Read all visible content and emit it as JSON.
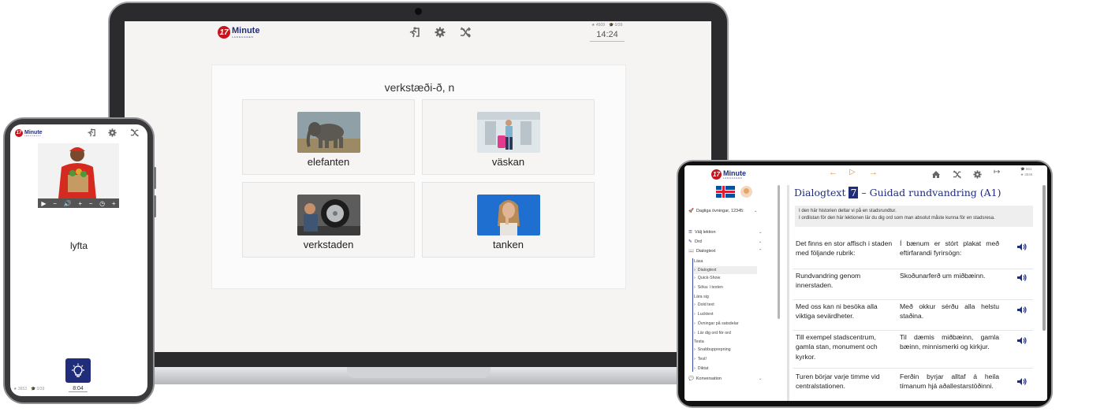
{
  "brand": {
    "logo_number": "17",
    "logo_name": "Minute",
    "logo_sub": "LANGUAGES",
    "accent": "#c8141c",
    "navy": "#1f2d7a"
  },
  "laptop": {
    "stats": {
      "stars": "4509",
      "hats": "0/39"
    },
    "timer": "14:24",
    "word": "verkstæði-ð, n",
    "choices": [
      {
        "label": "elefanten",
        "image": "elephant"
      },
      {
        "label": "väskan",
        "image": "suitcase-traveler"
      },
      {
        "label": "verkstaden",
        "image": "mechanic-tire"
      },
      {
        "label": "tanken",
        "image": "thinking-woman"
      }
    ],
    "toolbar": {
      "exit_icon": "exit-icon",
      "settings_icon": "gear-icon",
      "shuffle_icon": "shuffle-off-icon"
    }
  },
  "phone": {
    "word": "lyfta",
    "stats": {
      "stars": "3653",
      "hats": "0/39"
    },
    "timer": "8:04",
    "video_controls": [
      "play-icon",
      "minus-icon",
      "volume-icon",
      "plus-icon",
      "minus-icon",
      "speed-icon",
      "plus-icon"
    ],
    "hint_icon": "lightbulb-icon"
  },
  "tablet": {
    "stats": {
      "hats": "561",
      "stars": "3545"
    },
    "nav": {
      "prev_icon": "arrow-left-icon",
      "play_icon": "play-icon",
      "next_icon": "arrow-right-icon"
    },
    "sidebar": {
      "daily": "Dagliga övningar, 12345:",
      "choose_lesson": "Välj lektion",
      "words": "Ord",
      "dialog": "Dialogtext",
      "groups": [
        {
          "title": "Läsa",
          "items": [
            "Dialogtext",
            "Quick-Show",
            "Söka: i texten"
          ]
        },
        {
          "title": "Lära sig",
          "items": [
            "Dold text",
            "Lucktext",
            "Övningar på satsdelar",
            "Lär dig ord för ord"
          ]
        },
        {
          "title": "Testa",
          "items": [
            "Snabbupprepning",
            "Test!",
            "Diktat"
          ]
        }
      ],
      "conversation": "Konversation"
    },
    "title_prefix": "Dialogtext",
    "title_number": "7",
    "title_suffix": "– Guidad rundvandring (A1)",
    "intro_line1": "I den här historien deltar vi på en stadsrundtur.",
    "intro_line2": "I ordlistan för den här lektionen lär du dig ord som man absolut måste kunna för en stadsresa.",
    "rows": [
      {
        "sv": "Det finns en stor affisch i staden med följande rubrik:",
        "is": "Í bænum er stórt plakat með eftirfarandi fyrirsögn:"
      },
      {
        "sv": "Rundvandring genom innerstaden.",
        "is": "Skoðunarferð um miðbæinn."
      },
      {
        "sv": "Med oss kan ni besöka alla viktiga sevärdheter.",
        "is": "Með okkur sérðu alla helstu staðina."
      },
      {
        "sv": "Till exempel stadscentrum, gamla stan, monument och kyrkor.",
        "is": "Til dæmis miðbæinn, gamla bæinn, minnismerki og kirkjur."
      },
      {
        "sv": "Turen börjar varje timme vid centralstationen.",
        "is": "Ferðin byrjar alltaf á heila tímanum hjá aðallestarstöðinni."
      }
    ]
  }
}
